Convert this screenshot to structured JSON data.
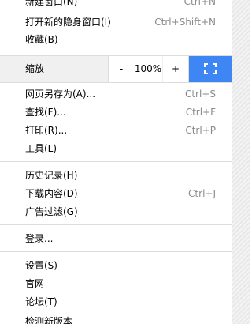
{
  "menu": {
    "new_window": {
      "label": "新建窗口(N)",
      "shortcut": "Ctrl+N"
    },
    "new_incognito": {
      "label": "打开新的隐身窗口(I)",
      "shortcut": "Ctrl+Shift+N"
    },
    "favorites": {
      "label": "收藏(B)"
    },
    "zoom": {
      "label": "缩放",
      "minus": "-",
      "value": "100%",
      "plus": "+"
    },
    "save_as": {
      "label": "网页另存为(A)...",
      "shortcut": "Ctrl+S"
    },
    "find": {
      "label": "查找(F)...",
      "shortcut": "Ctrl+F"
    },
    "print": {
      "label": "打印(R)...",
      "shortcut": "Ctrl+P"
    },
    "tools": {
      "label": "工具(L)"
    },
    "history": {
      "label": "历史记录(H)"
    },
    "downloads": {
      "label": "下载内容(D)",
      "shortcut": "Ctrl+J"
    },
    "adblock": {
      "label": "广告过滤(G)"
    },
    "login": {
      "label": "登录..."
    },
    "settings": {
      "label": "设置(S)"
    },
    "website": {
      "label": "官网"
    },
    "forum": {
      "label": "论坛(T)"
    },
    "check_update": {
      "label": "检测新版本"
    }
  },
  "colors": {
    "accent": "#3e86f3"
  }
}
